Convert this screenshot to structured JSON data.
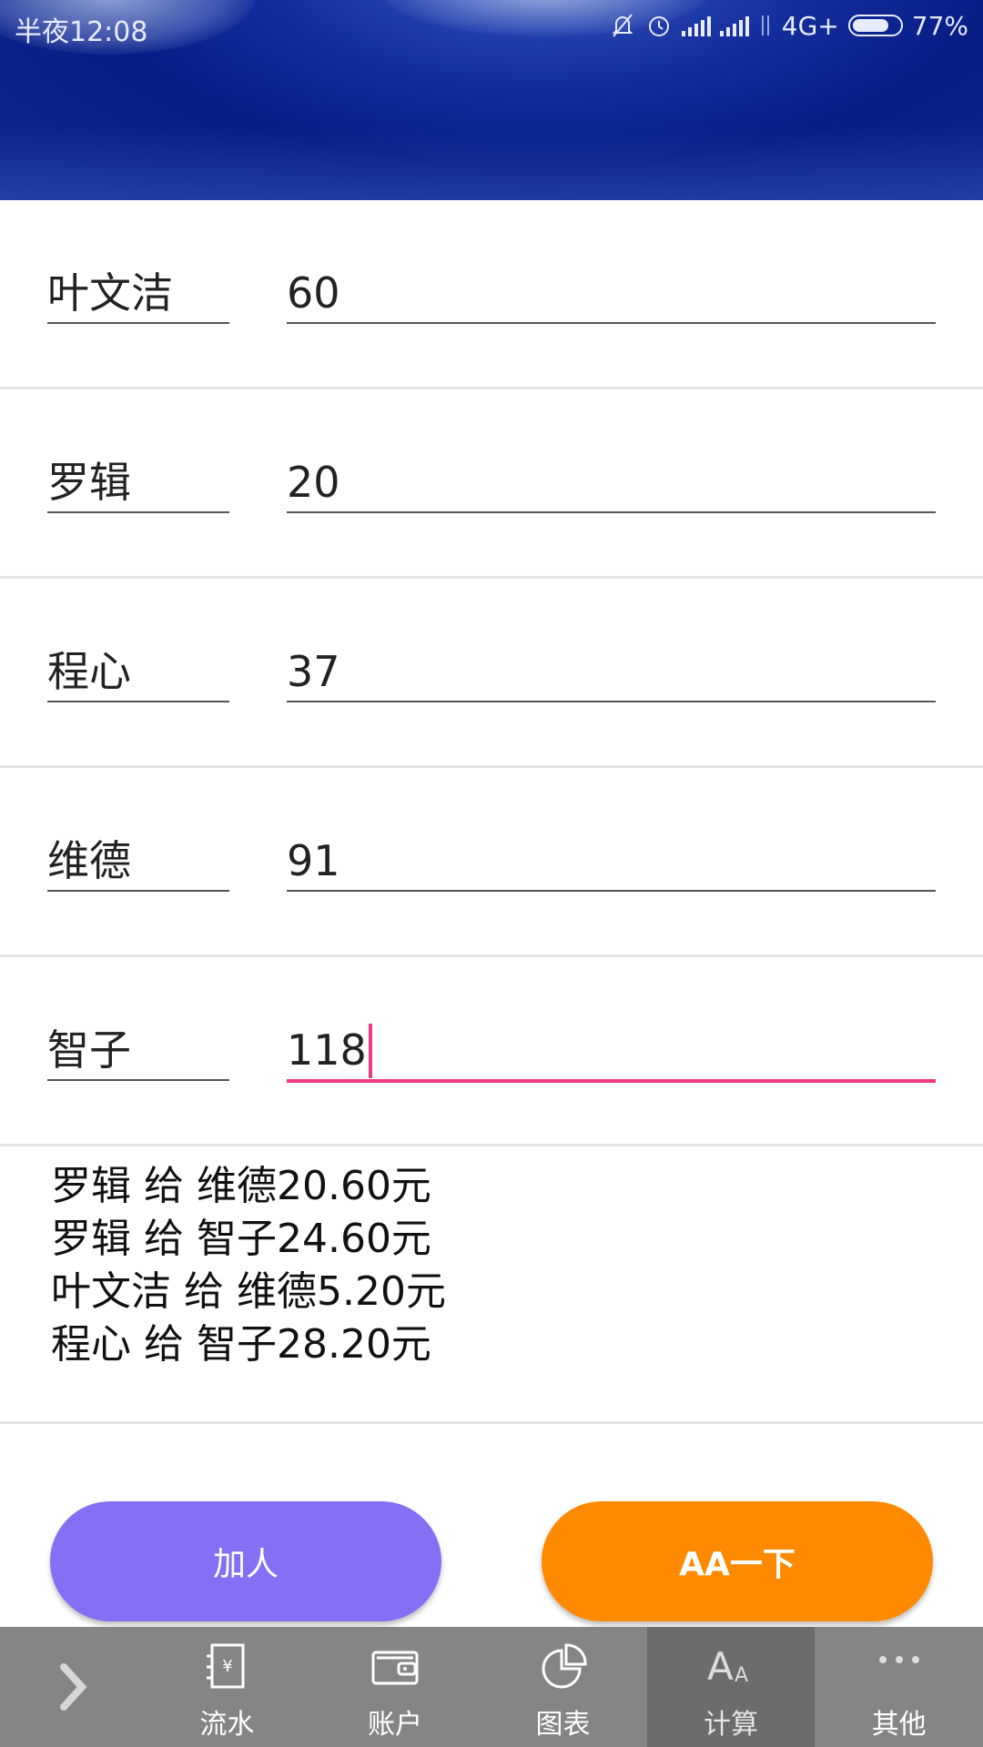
{
  "status_bar": {
    "time": "半夜12:08",
    "network": "4G+",
    "battery": "77%",
    "battery_level": 0.77
  },
  "rows": [
    {
      "name": "叶文洁",
      "amount": "60"
    },
    {
      "name": "罗辑",
      "amount": "20"
    },
    {
      "name": "程心",
      "amount": "37"
    },
    {
      "name": "维德",
      "amount": "91"
    },
    {
      "name": "智子",
      "amount": "118"
    }
  ],
  "results": [
    "罗辑 给 维德20.60元",
    "罗辑 给 智子24.60元",
    "叶文洁 给 维德5.20元",
    "程心 给 智子28.20元"
  ],
  "buttons": {
    "add_person": "加人",
    "aa": "AA一下"
  },
  "nav": {
    "items": [
      {
        "label": "流水",
        "icon": "bill-icon"
      },
      {
        "label": "账户",
        "icon": "wallet-icon"
      },
      {
        "label": "图表",
        "icon": "pie-chart-icon"
      },
      {
        "label": "计算",
        "icon": "font-size-icon"
      },
      {
        "label": "其他",
        "icon": "more-icon"
      }
    ],
    "active": "计算"
  },
  "colors": {
    "active_underline": "#f03b83",
    "add_button": "#8570f5",
    "aa_button": "#ff8a00",
    "nav_bg": "#858585",
    "nav_active_bg": "#6c6c6c"
  }
}
